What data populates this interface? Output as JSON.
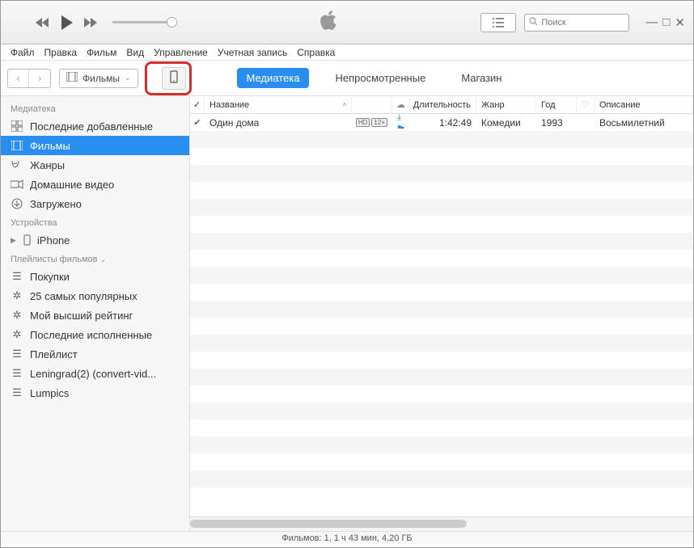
{
  "menubar": [
    "Файл",
    "Правка",
    "Фильм",
    "Вид",
    "Управление",
    "Учетная запись",
    "Справка"
  ],
  "media_selector": "Фильмы",
  "tabs": {
    "library": "Медиатека",
    "unwatched": "Непросмотренные",
    "store": "Магазин"
  },
  "search_placeholder": "Поиск",
  "sidebar": {
    "section_library": "Медиатека",
    "library_items": [
      "Последние добавленные",
      "Фильмы",
      "Жанры",
      "Домашние видео",
      "Загружено"
    ],
    "library_selected_index": 1,
    "section_devices": "Устройства",
    "devices": [
      "iPhone"
    ],
    "section_playlists": "Плейлисты фильмов",
    "playlist_items": [
      "Покупки",
      "25 самых популярных",
      "Мой высший рейтинг",
      "Последние исполненные",
      "Плейлист",
      "Leningrad(2)  (convert-vid...",
      "Lumpics"
    ]
  },
  "columns": {
    "check": "✓",
    "name": "Название",
    "cloud": "",
    "duration": "Длительность",
    "genre": "Жанр",
    "year": "Год",
    "heart": "",
    "desc": "Описание"
  },
  "rows": [
    {
      "checked": true,
      "name": "Один дома",
      "hd": "HD",
      "age": "12+",
      "cloud": true,
      "duration": "1:42:49",
      "genre": "Комедии",
      "year": "1993",
      "desc": "Восьмилетний"
    }
  ],
  "status": "Фильмов: 1, 1 ч 43 мин, 4,20 ГБ"
}
